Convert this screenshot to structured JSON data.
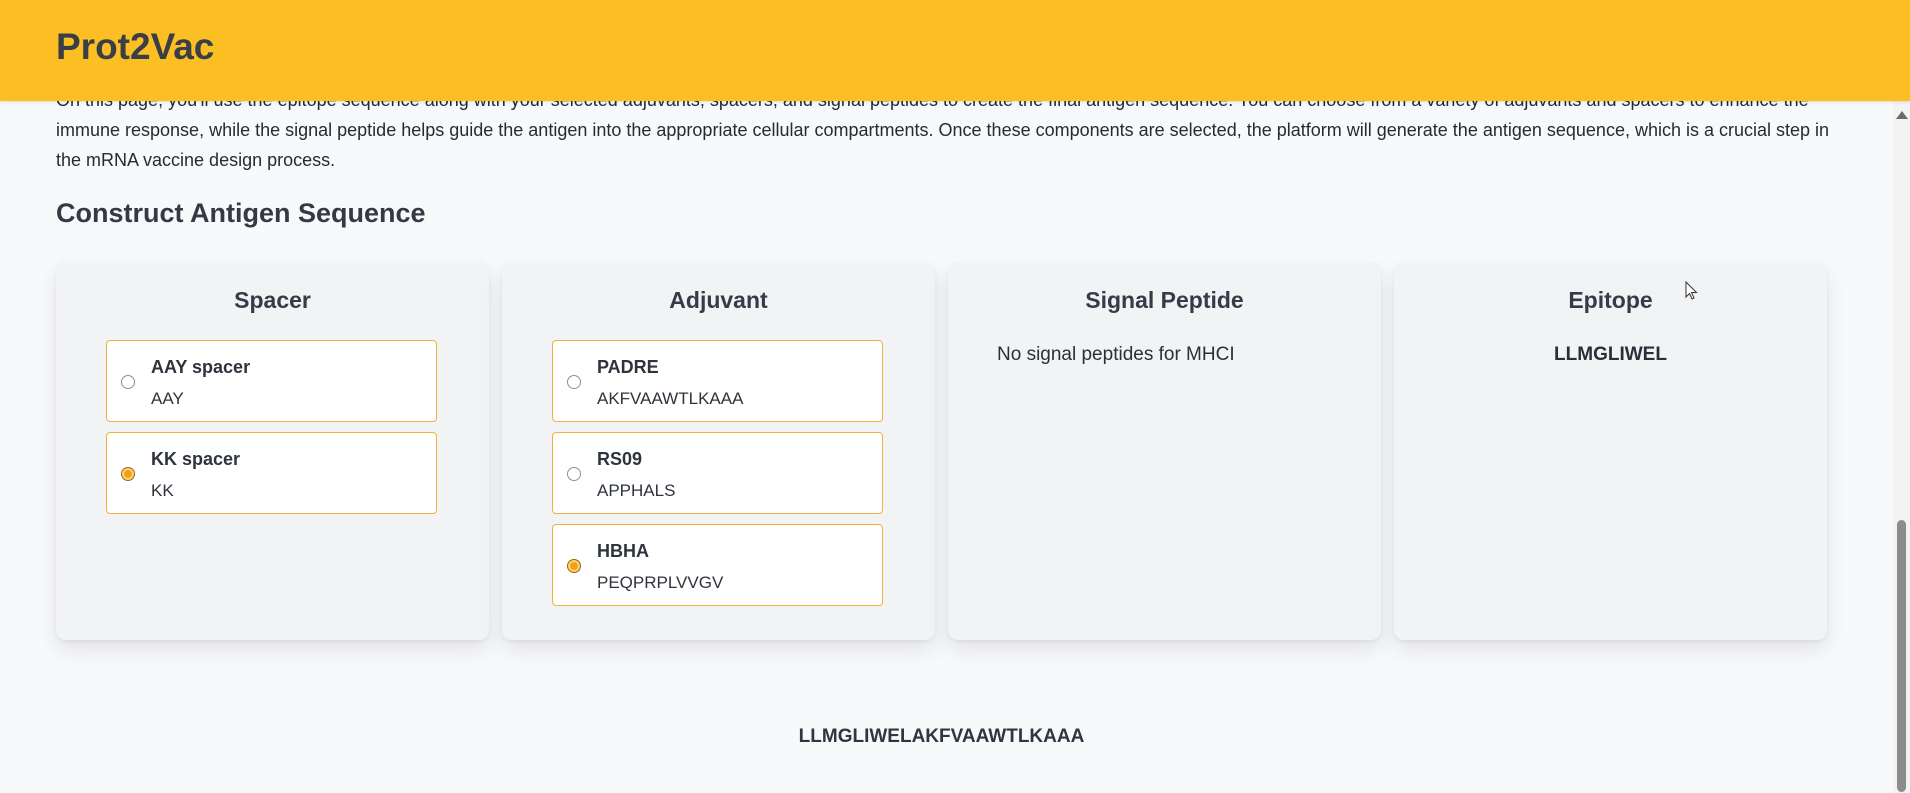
{
  "app": {
    "title": "Prot2Vac"
  },
  "intro": {
    "text": "On this page, you'll use the epitope sequence along with your selected adjuvants, spacers, and signal peptides to create the final antigen sequence. You can choose from a variety of adjuvants and spacers to enhance the immune response, while the signal peptide helps guide the antigen into the appropriate cellular compartments. Once these components are selected, the platform will generate the antigen sequence, which is a crucial step in the mRNA vaccine design process."
  },
  "section": {
    "title": "Construct Antigen Sequence"
  },
  "spacer": {
    "title": "Spacer",
    "options": [
      {
        "name": "AAY spacer",
        "sequence": "AAY",
        "selected": false
      },
      {
        "name": "KK spacer",
        "sequence": "KK",
        "selected": true
      }
    ]
  },
  "adjuvant": {
    "title": "Adjuvant",
    "options": [
      {
        "name": "PADRE",
        "sequence": "AKFVAAWTLKAAA",
        "selected": false
      },
      {
        "name": "RS09",
        "sequence": "APPHALS",
        "selected": false
      },
      {
        "name": "HBHA",
        "sequence": "PEQPRPLVVGV",
        "selected": true
      }
    ]
  },
  "signal_peptide": {
    "title": "Signal Peptide",
    "message": "No signal peptides for MHCI"
  },
  "epitope": {
    "title": "Epitope",
    "sequence": "LLMGLIWEL"
  },
  "result": {
    "sequence": "LLMGLIWELAKFVAAWTLKAAA"
  },
  "colors": {
    "header": "#fbbf24",
    "option_border": "#f0b23a",
    "radio_selected": "#f5a10e"
  }
}
